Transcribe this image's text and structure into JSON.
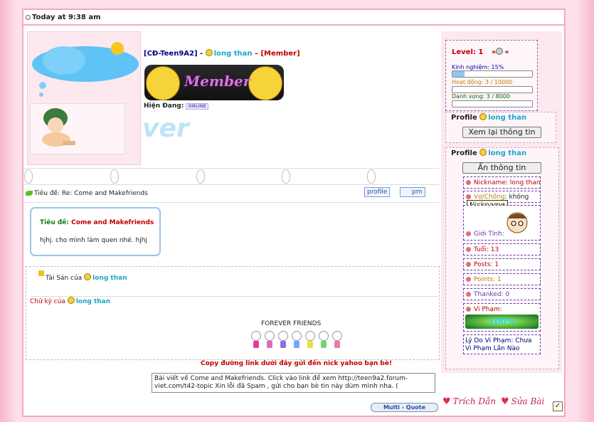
{
  "header": {
    "timestamp": "Today at 9:38 am"
  },
  "user": {
    "group": "[CĐ-Teen9A2]",
    "sep": " - ",
    "name": "long than",
    "dash": " – ",
    "role": "[Member]",
    "rank_badge": "Member",
    "status_label": "Hiện Đang:",
    "status_value": "ONLINE",
    "bg_text": "ver"
  },
  "stats": {
    "level_label": "Level: 1",
    "level_arrows": "»",
    "level_arrows2": "«",
    "exp_label": "Kinh nghiệm: 15%",
    "exp_percent": 15,
    "activity_label": "Hoạt động: 3 / 10000",
    "activity_fraction": 0.0003,
    "reputation_label": "Danh vọng: 3 / 8000",
    "reputation_fraction": 0.000375
  },
  "profile1": {
    "label": "Profile",
    "name": "long than",
    "button": "Xem lại thông tin"
  },
  "profile2": {
    "label": "Profile",
    "name": "long than",
    "button": "Ẩn thông tin"
  },
  "fields": {
    "nickname": "Nickname: long than",
    "spouse_key": "Vợ/Chồng",
    "spouse_val": ": không",
    "tooltip": "Nickname",
    "gender": "Giới Tính:",
    "age": "Tuổi: 13",
    "posts": "Posts: 1",
    "points": "Points: 1",
    "thanked": "Thanked: 0",
    "violation": "Vi Phạm:",
    "violation_badge": "100%",
    "reason": "Lý Do Vi Phạm: Chưa Vi Phạm Lần Nào"
  },
  "post": {
    "title_prefix": "Tiêu đề: Re: Come and Makefriends",
    "profile_btn": "profile",
    "pm_btn": "pm",
    "bubble_title_label": "Tiêu đề:",
    "bubble_title": "Come and Makefriends",
    "bubble_body": "hjhj. cho mình làm quen nhé. hjhj",
    "assets_label": "Tài Sản của",
    "assets_user": "long than",
    "sig_label": "Chữ ký của",
    "sig_user": "long than",
    "forever": "FOREVER FRIENDS",
    "copy_hint": "Copy đường link dưới đây gửi đến nick yahoo bạn bè!",
    "share_text": "Bài viết về Come and Makefriends. Click vào link để xem http://teen9a2.forum-viet.com/t42-topic Xin lỗi đã Spam , gửi cho bạn bè tin này dùm mình nha. (",
    "multi_quote": "Multi - Quote",
    "quote": "Trích Dẫn",
    "edit": "Sửa Bài"
  },
  "colors": {
    "accent_pink": "#f2a8c4",
    "bg_pink": "#fde0ea",
    "cyan": "#1aa7c9",
    "dark_red": "#c00000",
    "navy": "#000080"
  }
}
